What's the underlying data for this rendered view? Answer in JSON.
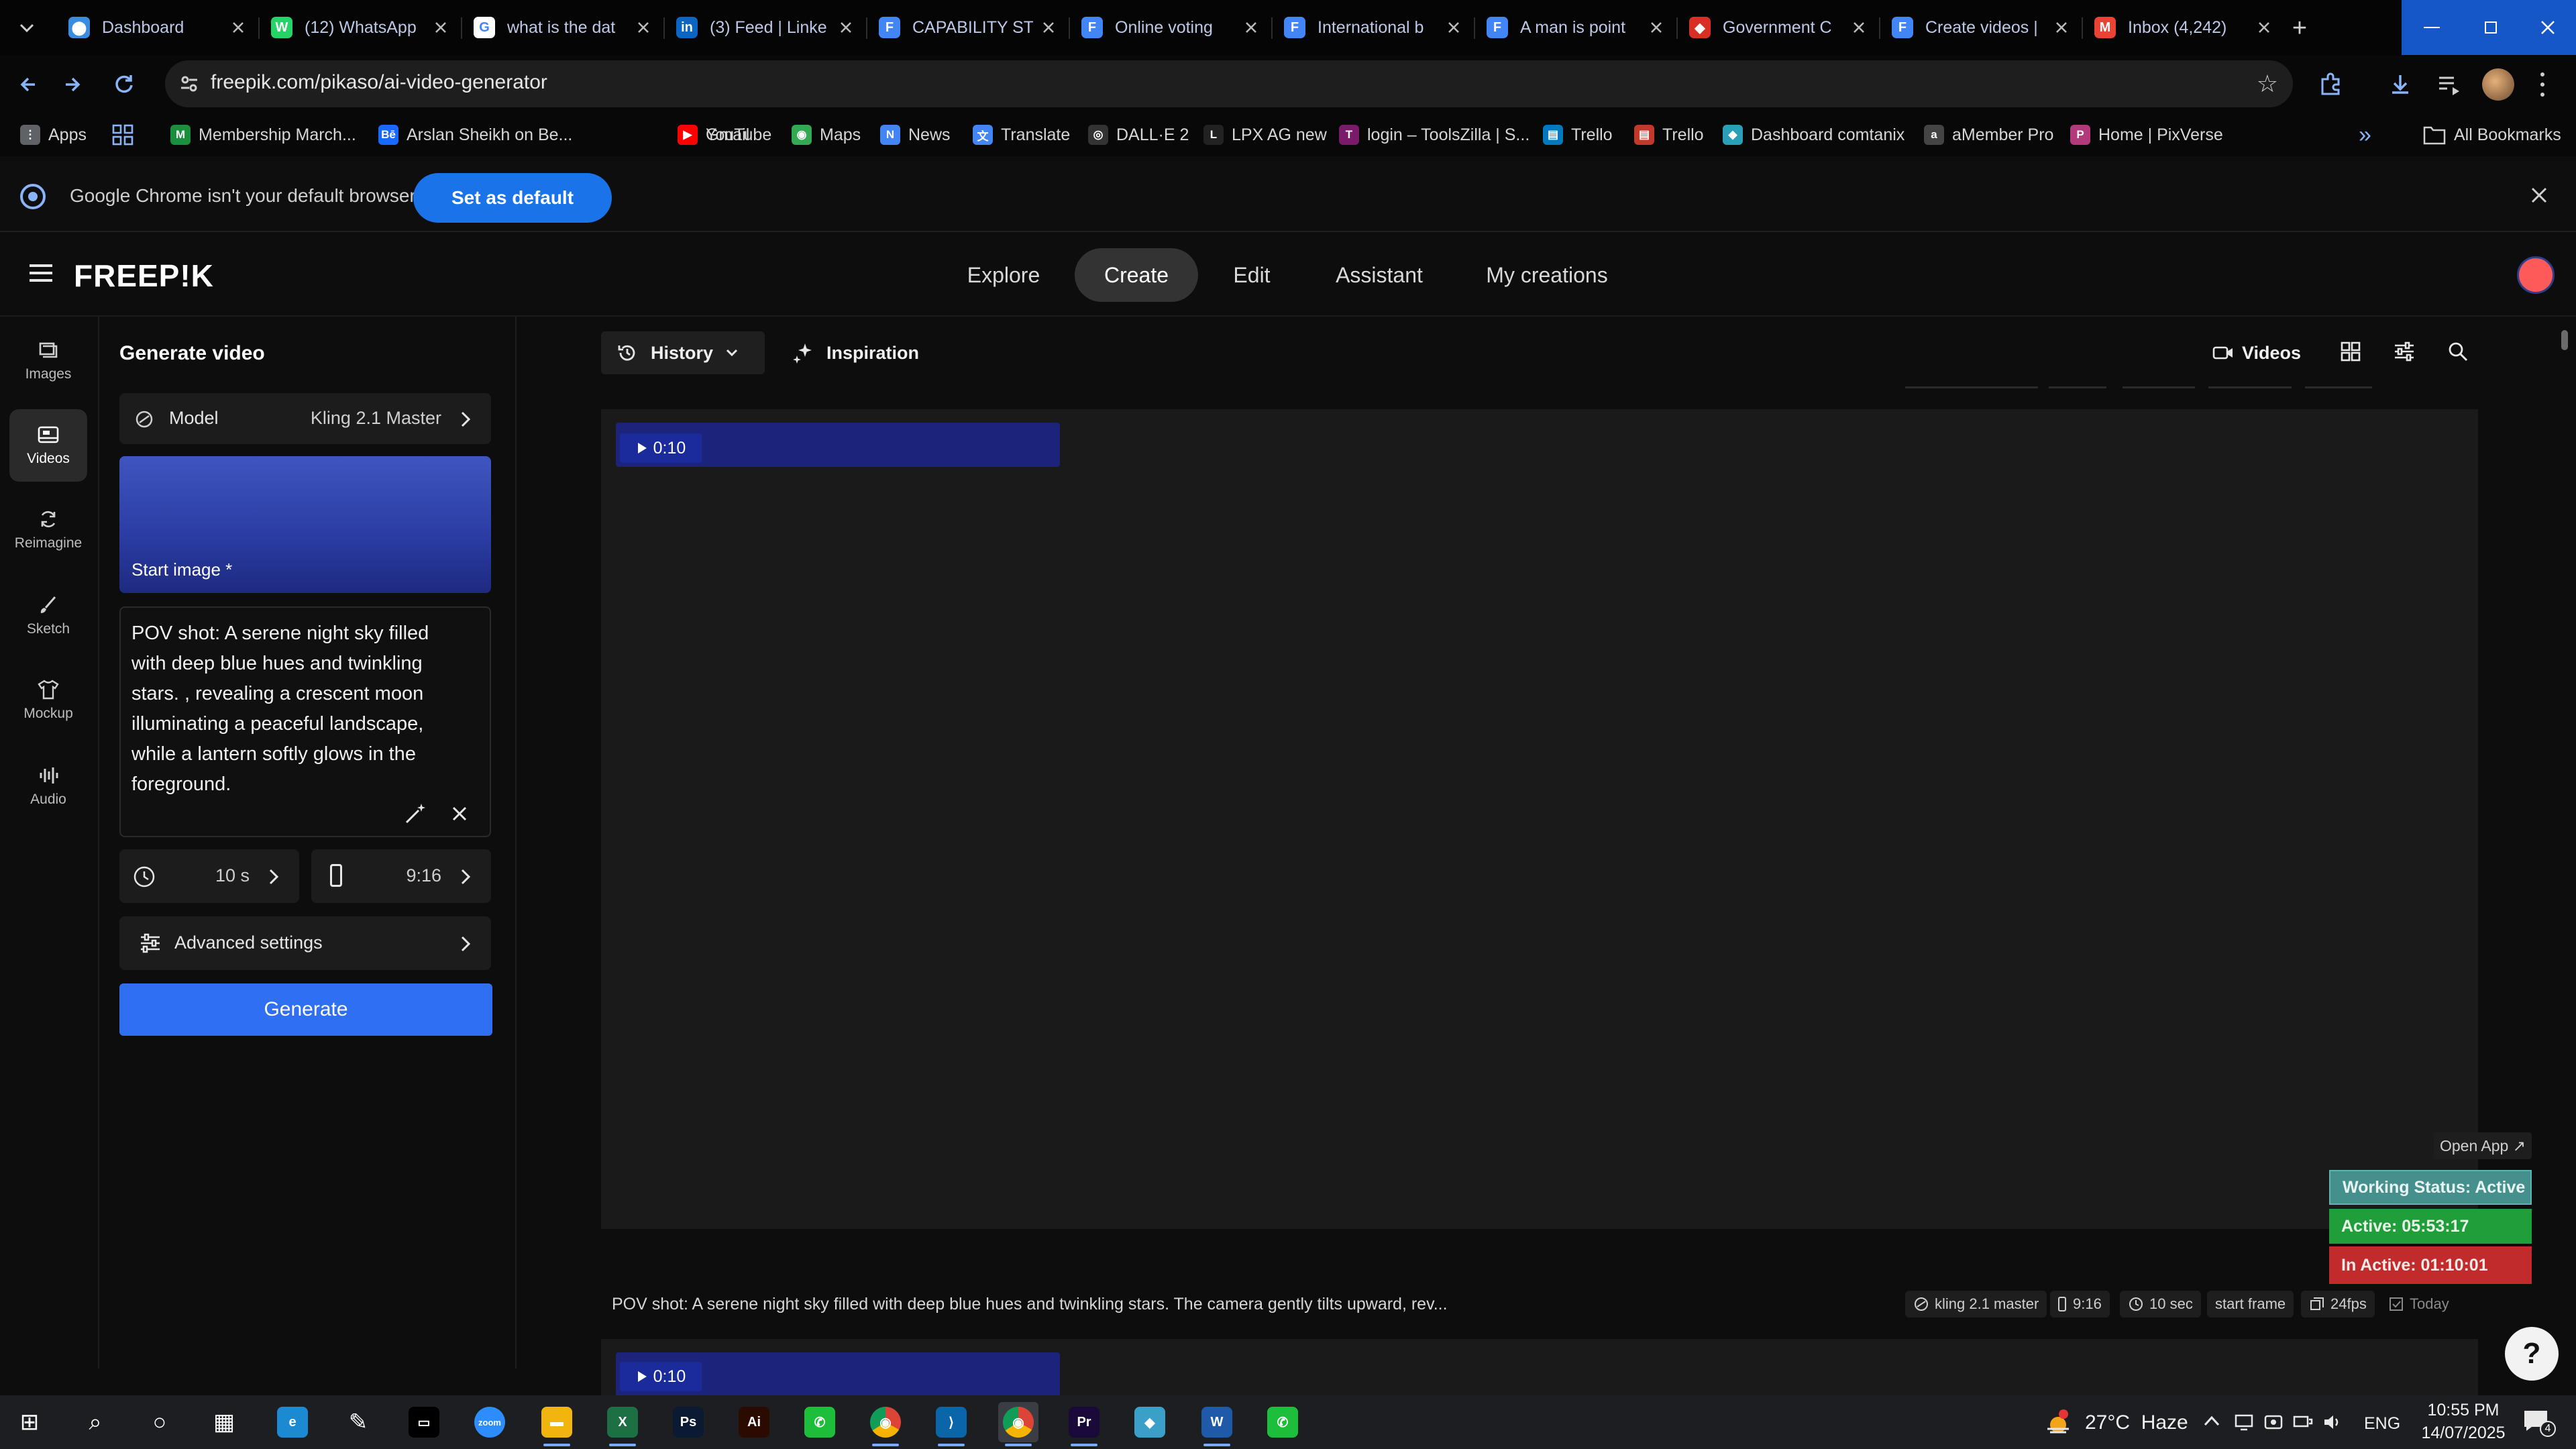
{
  "browser": {
    "tabs": [
      {
        "title": "Dashboard",
        "color": "#3a8dde",
        "glyph": "⬤"
      },
      {
        "title": "(12) WhatsApp",
        "color": "#25d366",
        "glyph": "W"
      },
      {
        "title": "what is the dat",
        "color": "#ffffff",
        "glyph": "G"
      },
      {
        "title": "(3) Feed | Linke",
        "color": "#0a66c2",
        "glyph": "in"
      },
      {
        "title": "CAPABILITY ST",
        "color": "#4285f4",
        "glyph": "F"
      },
      {
        "title": "Online voting",
        "color": "#4285f4",
        "glyph": "F"
      },
      {
        "title": "International b",
        "color": "#4285f4",
        "glyph": "F"
      },
      {
        "title": "A man is point",
        "color": "#4285f4",
        "glyph": "F"
      },
      {
        "title": "Government C",
        "color": "#d93025",
        "glyph": "◆"
      },
      {
        "title": "Create videos |",
        "color": "#4285f4",
        "glyph": "F"
      },
      {
        "title": "Inbox (4,242)",
        "color": "#ea4335",
        "glyph": "M"
      }
    ],
    "url": "freepik.com/pikaso/ai-video-generator",
    "bookmarks": [
      {
        "label": "Apps",
        "color": "#5f6368",
        "glyph": "⋮"
      },
      {
        "label": "Membership March...",
        "color": "#1a8f3c",
        "glyph": "M"
      },
      {
        "label": "Arslan Sheikh on Be...",
        "color": "#1769ff",
        "glyph": "Bē"
      },
      {
        "label": "Gmail",
        "color": "#ea4335",
        "glyph": "M"
      },
      {
        "label": "YouTube",
        "color": "#ff0000",
        "glyph": "▶"
      },
      {
        "label": "Maps",
        "color": "#34a853",
        "glyph": "◉"
      },
      {
        "label": "News",
        "color": "#4285f4",
        "glyph": "N"
      },
      {
        "label": "Translate",
        "color": "#4285f4",
        "glyph": "文"
      },
      {
        "label": "DALL·E 2",
        "color": "#333333",
        "glyph": "◎"
      },
      {
        "label": "LPX AG new",
        "color": "#222222",
        "glyph": "L"
      },
      {
        "label": "login – ToolsZilla | S...",
        "color": "#7a1a6a",
        "glyph": "T"
      },
      {
        "label": "Trello",
        "color": "#0079bf",
        "glyph": "▤"
      },
      {
        "label": "Trello",
        "color": "#c0392b",
        "glyph": "▤"
      },
      {
        "label": "Dashboard comtanix",
        "color": "#2aa0b8",
        "glyph": "◆"
      },
      {
        "label": "aMember Pro",
        "color": "#444444",
        "glyph": "a"
      },
      {
        "label": "Home | PixVerse",
        "color": "#b23a7a",
        "glyph": "P"
      }
    ],
    "all_bookmarks": "All Bookmarks",
    "banner_text": "Google Chrome isn't your default browser",
    "banner_button": "Set as default"
  },
  "freepik": {
    "logo": "FREEP!K",
    "nav": [
      "Explore",
      "Create",
      "Edit",
      "Assistant",
      "My creations"
    ],
    "rail": [
      {
        "label": "Images",
        "icon": "image-icon"
      },
      {
        "label": "Videos",
        "icon": "video-icon"
      },
      {
        "label": "Reimagine",
        "icon": "refresh-icon"
      },
      {
        "label": "Sketch",
        "icon": "brush-icon"
      },
      {
        "label": "Mockup",
        "icon": "shirt-icon"
      },
      {
        "label": "Audio",
        "icon": "audio-icon"
      }
    ],
    "panel": {
      "title": "Generate video",
      "model_label": "Model",
      "model_value": "Kling 2.1 Master",
      "start_image_label": "Start image *",
      "prompt": "POV shot: A serene night sky filled with deep blue hues and twinkling stars. , revealing a crescent moon illuminating a peaceful landscape, while a lantern softly glows in the foreground.",
      "duration": "10 s",
      "aspect": "9:16",
      "advanced": "Advanced settings",
      "generate": "Generate"
    },
    "toolbar": {
      "history": "History",
      "inspiration": "Inspiration",
      "videos": "Videos"
    },
    "video": {
      "duration_badge": "0:10",
      "prompt_preview": "POV shot: A serene night sky filled with deep blue hues and twinkling stars. The camera gently tilts upward, rev...",
      "meta": [
        "kling 2.1 master",
        "9:16",
        "10 sec",
        "start frame",
        "24fps",
        "Today"
      ],
      "second_badge": "0:10"
    },
    "status_widget": {
      "open_app": "Open App ↗",
      "working": "Working Status: Active",
      "active": "Active: 05:53:17",
      "inactive": "In Active: 01:10:01"
    },
    "help": "?"
  },
  "taskbar": {
    "weather": "27°C  Haze",
    "lang": "ENG",
    "time": "10:55 PM",
    "date": "14/07/2025",
    "notifications": "4",
    "apps": [
      {
        "name": "start",
        "color": "#1c1e22",
        "glyph": "⊞"
      },
      {
        "name": "search",
        "color": "#1c1e22",
        "glyph": "⌕"
      },
      {
        "name": "cortana",
        "color": "#1c1e22",
        "glyph": "○"
      },
      {
        "name": "task-view",
        "color": "#1c1e22",
        "glyph": "▦"
      },
      {
        "name": "edge",
        "color": "#1b8ad3",
        "glyph": "e"
      },
      {
        "name": "pen",
        "color": "#1c1e22",
        "glyph": "✎"
      },
      {
        "name": "terminal",
        "color": "#000000",
        "glyph": "▭"
      },
      {
        "name": "zoom",
        "color": "#2d8cff",
        "glyph": "zoom"
      },
      {
        "name": "explorer",
        "color": "#f2b50f",
        "glyph": "▬"
      },
      {
        "name": "excel",
        "color": "#1d7044",
        "glyph": "X"
      },
      {
        "name": "photoshop",
        "color": "#0b1a33",
        "glyph": "Ps"
      },
      {
        "name": "illustrator",
        "color": "#2b0a00",
        "glyph": "Ai"
      },
      {
        "name": "phone-green",
        "color": "#1dbf3a",
        "glyph": "✆"
      },
      {
        "name": "chrome",
        "color": "#db4437",
        "glyph": "◉"
      },
      {
        "name": "vscode",
        "color": "#0a65a9",
        "glyph": "⟩"
      },
      {
        "name": "chrome-active",
        "color": "#db4437",
        "glyph": "◉"
      },
      {
        "name": "premiere",
        "color": "#1a0a3a",
        "glyph": "Pr"
      },
      {
        "name": "app-diamond",
        "color": "#3aa0c8",
        "glyph": "◆"
      },
      {
        "name": "word",
        "color": "#1e5aa8",
        "glyph": "W"
      },
      {
        "name": "phone-green-2",
        "color": "#1dbf3a",
        "glyph": "✆"
      }
    ]
  }
}
